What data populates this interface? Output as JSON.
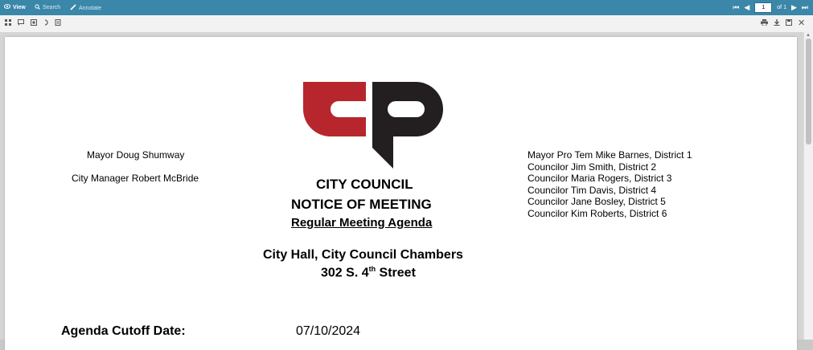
{
  "viewer": {
    "nav": {
      "view": "View",
      "search": "Search",
      "annotate": "Annotate"
    },
    "pager": {
      "current_page": "1",
      "of_pages": "of 1"
    }
  },
  "document": {
    "left_officials": {
      "mayor": "Mayor Doug Shumway",
      "manager": "City Manager Robert McBride"
    },
    "right_officials": [
      "Mayor Pro Tem Mike Barnes, District 1",
      "Councilor Jim Smith, District 2",
      "Councilor Maria Rogers, District 3",
      "Councilor Tim Davis, District 4",
      "Councilor Jane Bosley, District 5",
      "Councilor Kim Roberts, District 6"
    ],
    "heading": {
      "line1": "CITY COUNCIL",
      "line2": "NOTICE OF MEETING",
      "line3": "Regular Meeting Agenda"
    },
    "location": {
      "line1": "City Hall, City Council Chambers",
      "street_prefix": "302 S. 4",
      "street_suffix_sup": "th",
      "street_rest": " Street"
    },
    "cutoff": {
      "label": "Agenda Cutoff Date:",
      "value": "07/10/2024"
    }
  },
  "colors": {
    "topbar": "#3a87a9",
    "logo_red": "#b8262d",
    "logo_dark": "#231f20"
  }
}
